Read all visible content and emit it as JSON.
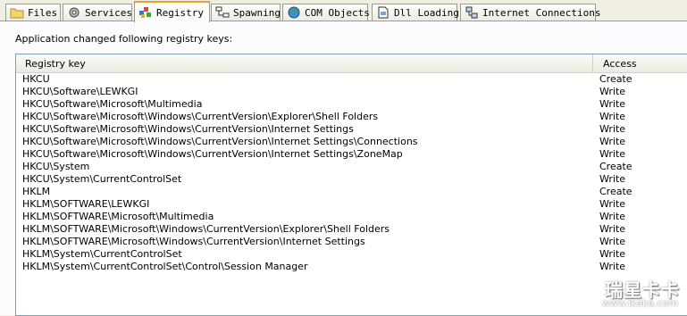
{
  "tabs": [
    {
      "label": "Files",
      "icon": "folder-icon"
    },
    {
      "label": "Services",
      "icon": "gear-icon"
    },
    {
      "label": "Registry",
      "icon": "registry-icon",
      "active": true
    },
    {
      "label": "Spawning",
      "icon": "process-tree-icon"
    },
    {
      "label": "COM Objects",
      "icon": "globe-icon"
    },
    {
      "label": "Dll Loading",
      "icon": "dll-file-icon"
    },
    {
      "label": "Internet Connections",
      "icon": "network-icon"
    }
  ],
  "caption": "Application changed following registry keys:",
  "table": {
    "headers": {
      "key": "Registry key",
      "access": "Access"
    },
    "rows": [
      {
        "key": "HKCU",
        "access": "Create"
      },
      {
        "key": "HKCU\\Software\\LEWKGI",
        "access": "Write"
      },
      {
        "key": "HKCU\\Software\\Microsoft\\Multimedia",
        "access": "Write"
      },
      {
        "key": "HKCU\\Software\\Microsoft\\Windows\\CurrentVersion\\Explorer\\Shell Folders",
        "access": "Write"
      },
      {
        "key": "HKCU\\Software\\Microsoft\\Windows\\CurrentVersion\\Internet Settings",
        "access": "Write"
      },
      {
        "key": "HKCU\\Software\\Microsoft\\Windows\\CurrentVersion\\Internet Settings\\Connections",
        "access": "Write"
      },
      {
        "key": "HKCU\\Software\\Microsoft\\Windows\\CurrentVersion\\Internet Settings\\ZoneMap",
        "access": "Write"
      },
      {
        "key": "HKCU\\System",
        "access": "Create"
      },
      {
        "key": "HKCU\\System\\CurrentControlSet",
        "access": "Write"
      },
      {
        "key": "HKLM",
        "access": "Create"
      },
      {
        "key": "HKLM\\SOFTWARE\\LEWKGI",
        "access": "Write"
      },
      {
        "key": "HKLM\\SOFTWARE\\Microsoft\\Multimedia",
        "access": "Write"
      },
      {
        "key": "HKLM\\SOFTWARE\\Microsoft\\Windows\\CurrentVersion\\Explorer\\Shell Folders",
        "access": "Write"
      },
      {
        "key": "HKLM\\SOFTWARE\\Microsoft\\Windows\\CurrentVersion\\Internet Settings",
        "access": "Write"
      },
      {
        "key": "HKLM\\System\\CurrentControlSet",
        "access": "Write"
      },
      {
        "key": "HKLM\\System\\CurrentControlSet\\Control\\Session Manager",
        "access": "Write"
      }
    ]
  },
  "watermark": {
    "main": "瑞星卡卡",
    "sub": "www.ikaka.com"
  },
  "colors": {
    "active_tab_accent": "#e8a428",
    "list_border": "#7f9db9",
    "panel_bg": "#f1efe2"
  }
}
